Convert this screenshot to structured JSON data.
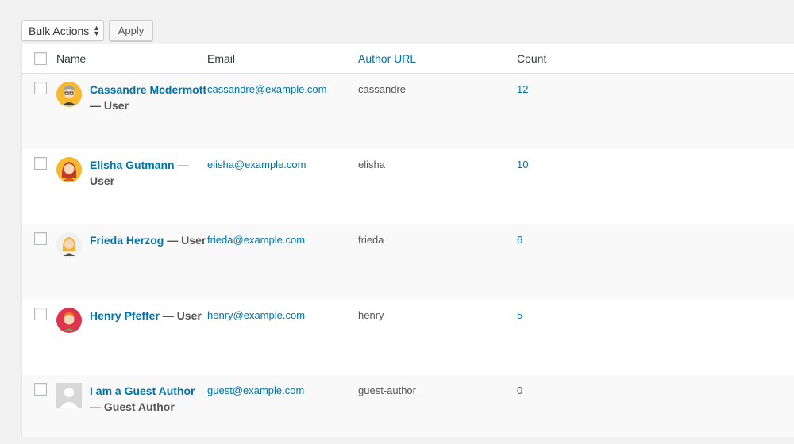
{
  "toolbar": {
    "bulk_actions_label": "Bulk Actions",
    "apply_label": "Apply"
  },
  "columns": {
    "name": "Name",
    "email": "Email",
    "author_url": "Author URL",
    "count": "Count"
  },
  "rows": [
    {
      "name": "Cassandre Mcdermott",
      "suffix": " — User",
      "email": "cassandre@example.com",
      "url": "cassandre",
      "count": "12"
    },
    {
      "name": "Elisha Gutmann",
      "suffix": " — User",
      "email": "elisha@example.com",
      "url": "elisha",
      "count": "10"
    },
    {
      "name": "Frieda Herzog",
      "suffix": " — User",
      "email": "frieda@example.com",
      "url": "frieda",
      "count": "6"
    },
    {
      "name": "Henry Pfeffer",
      "suffix": " — User",
      "email": "henry@example.com",
      "url": "henry",
      "count": "5"
    },
    {
      "name": "I am a Guest Author",
      "suffix": " — Guest Author",
      "email": "guest@example.com",
      "url": "guest-author",
      "count": "0"
    }
  ],
  "colors": {
    "link": "#0073aa",
    "text": "#555555",
    "background": "#f1f1f1"
  },
  "icons": [
    "avatar-woman-glasses-icon",
    "avatar-woman-red-hair-icon",
    "avatar-woman-blonde-icon",
    "avatar-man-red-hair-icon",
    "avatar-placeholder-icon"
  ]
}
